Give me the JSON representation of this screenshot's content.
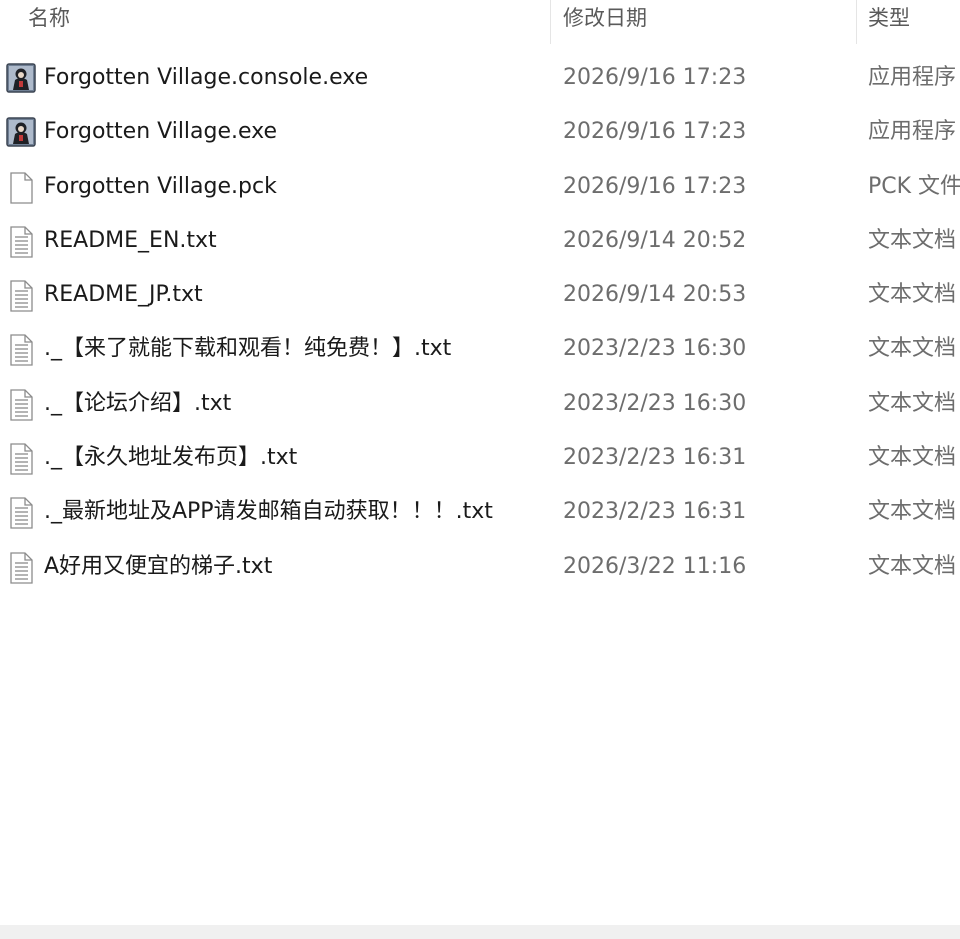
{
  "columns": {
    "name": "名称",
    "date": "修改日期",
    "type": "类型"
  },
  "files": [
    {
      "name": "Forgotten Village.console.exe",
      "date": "2026/9/16 17:23",
      "type": "应用程序",
      "icon": "app-character-icon"
    },
    {
      "name": "Forgotten Village.exe",
      "date": "2026/9/16 17:23",
      "type": "应用程序",
      "icon": "app-character-icon"
    },
    {
      "name": "Forgotten Village.pck",
      "date": "2026/9/16 17:23",
      "type": "PCK 文件",
      "icon": "blank-file-icon"
    },
    {
      "name": "README_EN.txt",
      "date": "2026/9/14 20:52",
      "type": "文本文档",
      "icon": "text-file-icon"
    },
    {
      "name": "README_JP.txt",
      "date": "2026/9/14 20:53",
      "type": "文本文档",
      "icon": "text-file-icon"
    },
    {
      "name": "._【来了就能下载和观看！纯免费！】.txt",
      "date": "2023/2/23 16:30",
      "type": "文本文档",
      "icon": "text-file-icon"
    },
    {
      "name": "._【论坛介绍】.txt",
      "date": "2023/2/23 16:30",
      "type": "文本文档",
      "icon": "text-file-icon"
    },
    {
      "name": "._【永久地址发布页】.txt",
      "date": "2023/2/23 16:31",
      "type": "文本文档",
      "icon": "text-file-icon"
    },
    {
      "name": "._最新地址及APP请发邮箱自动获取！！！.txt",
      "date": "2023/2/23 16:31",
      "type": "文本文档",
      "icon": "text-file-icon"
    },
    {
      "name": "A好用又便宜的梯子.txt",
      "date": "2026/3/22 11:16",
      "type": "文本文档",
      "icon": "text-file-icon"
    }
  ]
}
